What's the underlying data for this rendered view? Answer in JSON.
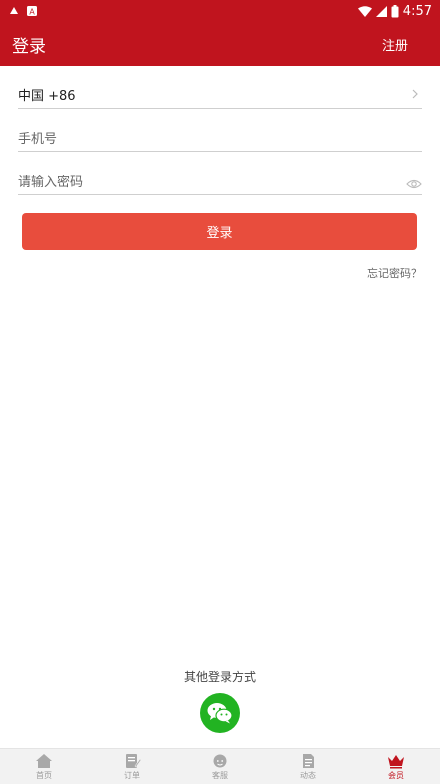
{
  "status_bar": {
    "time": "4:57"
  },
  "app_bar": {
    "title": "登录",
    "register_label": "注册"
  },
  "form": {
    "country_code": "中国 +86",
    "phone_placeholder": "手机号",
    "password_placeholder": "请输入密码"
  },
  "login_button": "登录",
  "forgot_password": "忘记密码？",
  "other_login": {
    "title": "其他登录方式"
  },
  "nav": {
    "items": [
      {
        "label": "首页",
        "icon": "home-icon"
      },
      {
        "label": "订单",
        "icon": "order-icon"
      },
      {
        "label": "客服",
        "icon": "customer-service-icon"
      },
      {
        "label": "动态",
        "icon": "news-icon"
      },
      {
        "label": "会员",
        "icon": "crown-icon",
        "active": true
      }
    ]
  },
  "colors": {
    "primary": "#c0141e",
    "button": "#e84d3d",
    "wechat": "#22b322"
  }
}
